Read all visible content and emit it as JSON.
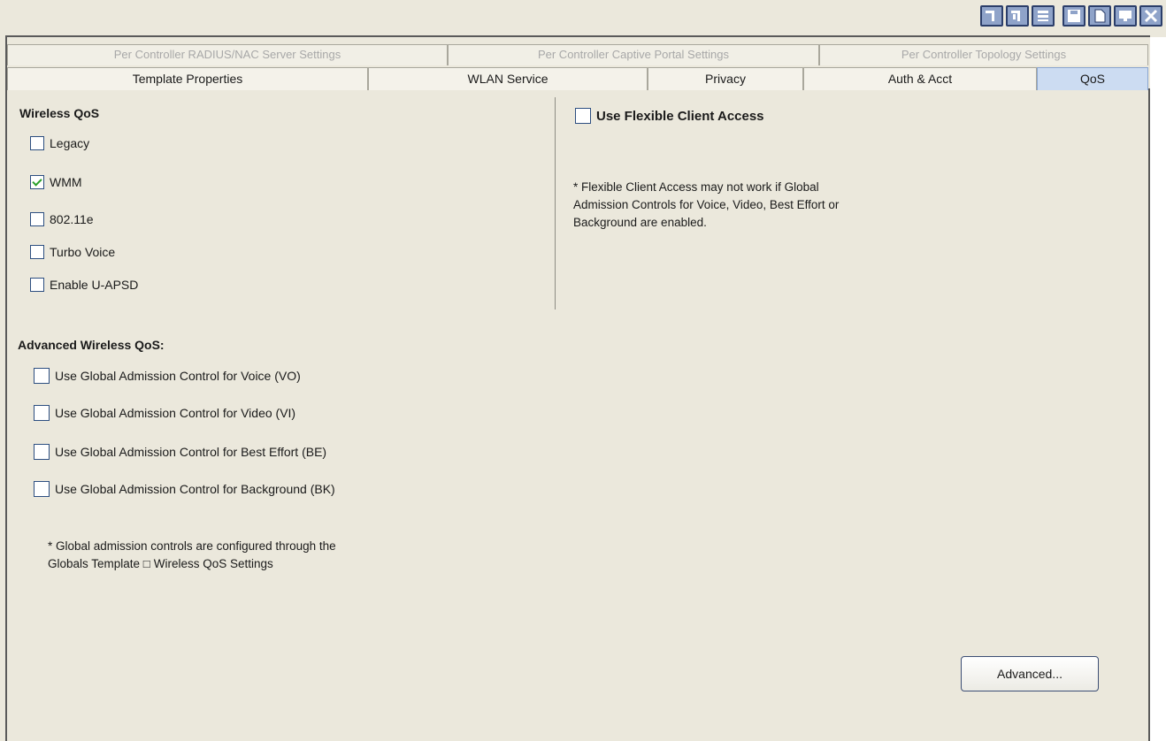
{
  "toolbar": {
    "buttons": [
      {
        "name": "restore-left-icon"
      },
      {
        "name": "restore-right-icon"
      },
      {
        "name": "stack-icon"
      },
      {
        "name": "save-icon"
      },
      {
        "name": "new-document-icon"
      },
      {
        "name": "monitor-icon"
      },
      {
        "name": "close-icon"
      }
    ]
  },
  "tabs_back": [
    {
      "label": "Per Controller RADIUS/NAC Server Settings"
    },
    {
      "label": "Per Controller Captive Portal Settings"
    },
    {
      "label": "Per Controller Topology Settings"
    }
  ],
  "tabs_front": [
    {
      "label": "Template Properties"
    },
    {
      "label": "WLAN Service"
    },
    {
      "label": "Privacy"
    },
    {
      "label": "Auth & Acct"
    },
    {
      "label": "QoS",
      "active": true
    }
  ],
  "wireless_qos": {
    "title": "Wireless QoS",
    "options": [
      {
        "label": "Legacy",
        "checked": false
      },
      {
        "label": "WMM",
        "checked": true
      },
      {
        "label": "802.11e",
        "checked": false
      },
      {
        "label": "Turbo Voice",
        "checked": false
      },
      {
        "label": "Enable U-APSD",
        "checked": false
      }
    ]
  },
  "flexible": {
    "label": "Use Flexible Client Access",
    "checked": false,
    "note_lines": [
      "* Flexible Client Access may not work if Global",
      "Admission Controls for Voice, Video, Best Effort or",
      "Background are enabled."
    ]
  },
  "advanced_qos": {
    "title": "Advanced Wireless QoS:",
    "options": [
      {
        "label": "Use Global Admission Control for Voice (VO)",
        "checked": false
      },
      {
        "label": "Use Global Admission Control for Video (VI)",
        "checked": false
      },
      {
        "label": "Use Global Admission Control for Best Effort (BE)",
        "checked": false
      },
      {
        "label": "Use Global Admission Control for Background (BK)",
        "checked": false
      }
    ],
    "note_lines": [
      "* Global admission controls are configured through the",
      "Globals Template □ Wireless QoS Settings"
    ]
  },
  "advanced_button": "Advanced..."
}
